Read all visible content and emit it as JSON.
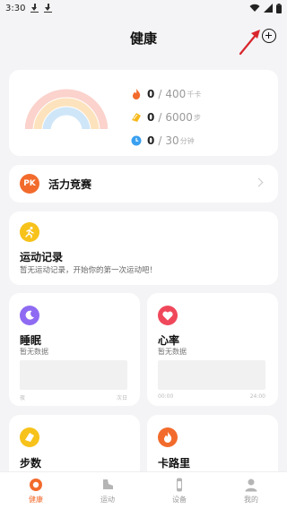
{
  "status_bar": {
    "time": "3:30"
  },
  "header": {
    "title": "健康"
  },
  "summary": {
    "metrics": [
      {
        "value": "0",
        "sep": "/",
        "goal": "400",
        "unit": "千卡",
        "icon": "flame-icon"
      },
      {
        "value": "0",
        "sep": "/",
        "goal": "6000",
        "unit": "步",
        "icon": "footprint-icon"
      },
      {
        "value": "0",
        "sep": "/",
        "goal": "30",
        "unit": "分钟",
        "icon": "clock-icon"
      }
    ]
  },
  "pk": {
    "badge": "PK",
    "label": "活力竞赛"
  },
  "sport": {
    "title": "运动记录",
    "desc": "暂无运动记录，开始你的第一次运动吧！"
  },
  "sleep": {
    "title": "睡眠",
    "sub": "暂无数据",
    "axis_left": "夜",
    "axis_right": "次日"
  },
  "heart": {
    "title": "心率",
    "sub": "暂无数据",
    "axis_left": "00:00",
    "axis_right": "24:00"
  },
  "steps": {
    "title": "步数"
  },
  "calories": {
    "title": "卡路里"
  },
  "tabs": [
    {
      "label": "健康",
      "icon": "health-ring-icon",
      "active": true
    },
    {
      "label": "运动",
      "icon": "shoe-icon",
      "active": false
    },
    {
      "label": "设备",
      "icon": "watch-icon",
      "active": false
    },
    {
      "label": "我的",
      "icon": "person-icon",
      "active": false
    }
  ],
  "colors": {
    "accent": "#f26b2c",
    "sleep_icon": "#8e6bf2",
    "heart_icon": "#f0485b",
    "sport_icon": "#f7c21a",
    "steps_icon": "#f7c21a",
    "cal_icon": "#f26b2c",
    "flame": "#f26b2c",
    "footprint": "#f7b91a",
    "clock": "#3aa0f0"
  }
}
